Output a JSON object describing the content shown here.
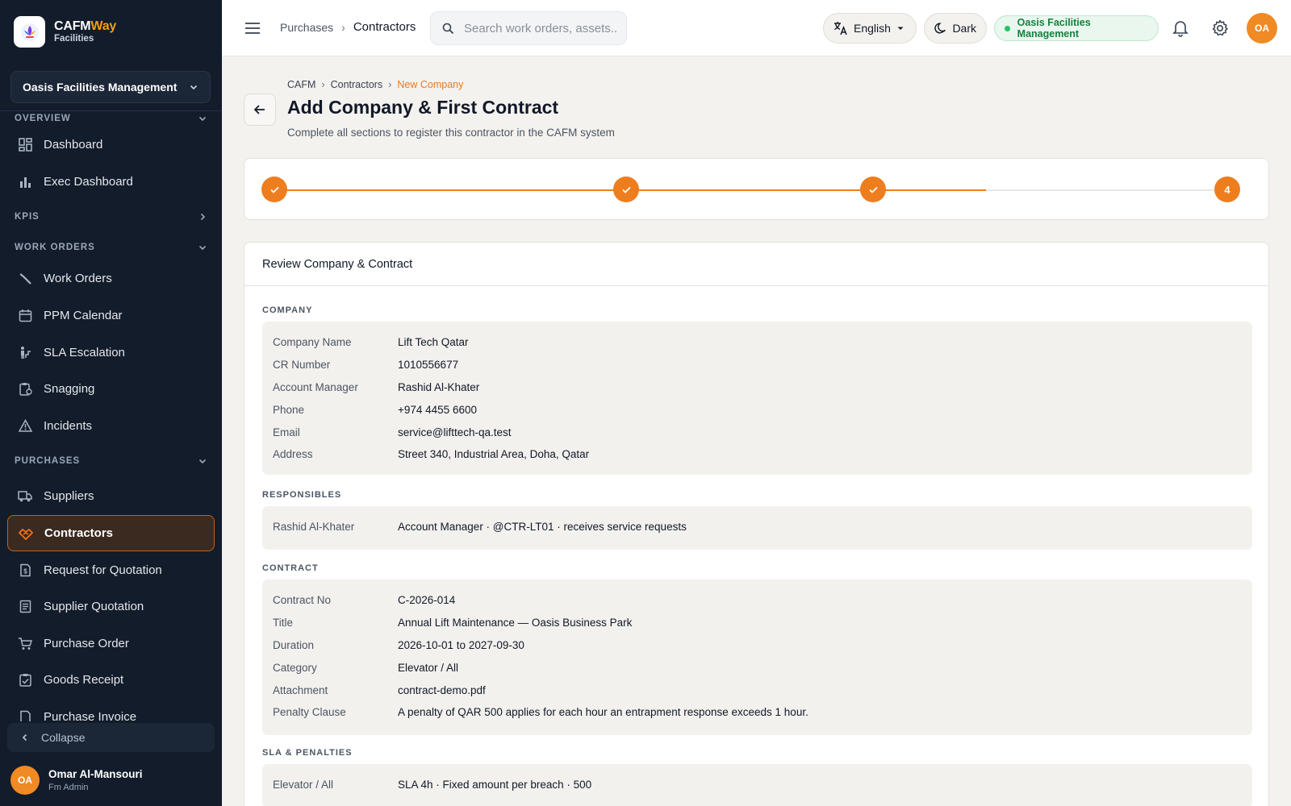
{
  "sidebar": {
    "brand_prefix": "CAFM",
    "brand_accent": "Way",
    "brand_sub": "Facilities",
    "org_select": "Oasis Facilities Management",
    "sections": {
      "overview": "OVERVIEW",
      "kpis": "KPIS",
      "work_orders": "WORK ORDERS",
      "purchases": "PURCHASES"
    },
    "items": {
      "dashboard": "Dashboard",
      "exec_dashboard": "Exec Dashboard",
      "work_orders": "Work Orders",
      "ppm_calendar": "PPM Calendar",
      "sla_escalation": "SLA Escalation",
      "snagging": "Snagging",
      "incidents": "Incidents",
      "suppliers": "Suppliers",
      "contractors": "Contractors",
      "rfq": "Request for Quotation",
      "supplier_quotation": "Supplier Quotation",
      "purchase_order": "Purchase Order",
      "goods_receipt": "Goods Receipt",
      "purchase_invoice": "Purchase Invoice"
    },
    "collapse": "Collapse",
    "user": {
      "initials": "OA",
      "name": "Omar Al-Mansouri",
      "role": "Fm Admin"
    }
  },
  "topbar": {
    "breadcrumb_parent": "Purchases",
    "breadcrumb_current": "Contractors",
    "search_placeholder": "Search work orders, assets...",
    "language": "English",
    "theme": "Dark",
    "org_badge": "Oasis Facilities Management",
    "avatar_initials": "OA"
  },
  "page": {
    "breadcrumb": [
      "CAFM",
      "Contractors",
      "New Company"
    ],
    "title": "Add Company & First Contract",
    "subtitle": "Complete all sections to register this contractor in the CAFM system"
  },
  "stepper": {
    "steps_completed": 3,
    "current_step_label": "4",
    "accent": "#ee7d1e"
  },
  "review": {
    "heading": "Review Company & Contract",
    "company": {
      "title": "COMPANY",
      "rows": [
        {
          "k": "Company Name",
          "v": "Lift Tech Qatar"
        },
        {
          "k": "CR Number",
          "v": "1010556677"
        },
        {
          "k": "Account Manager",
          "v": "Rashid Al-Khater"
        },
        {
          "k": "Phone",
          "v": "+974 4455 6600"
        },
        {
          "k": "Email",
          "v": "service@lifttech-qa.test"
        },
        {
          "k": "Address",
          "v": "Street 340, Industrial Area, Doha, Qatar"
        }
      ]
    },
    "responsibles": {
      "title": "RESPONSIBLES",
      "rows": [
        {
          "k": "Rashid Al-Khater",
          "v": "Account Manager · @CTR-LT01 · receives service requests"
        }
      ]
    },
    "contract": {
      "title": "CONTRACT",
      "rows": [
        {
          "k": "Contract No",
          "v": "C-2026-014"
        },
        {
          "k": "Title",
          "v": "Annual Lift Maintenance — Oasis Business Park"
        },
        {
          "k": "Duration",
          "v": "2026-10-01 to 2027-09-30"
        },
        {
          "k": "Category",
          "v": "Elevator / All"
        },
        {
          "k": "Attachment",
          "v": "contract-demo.pdf"
        },
        {
          "k": "Penalty Clause",
          "v": "A penalty of QAR 500 applies for each hour an entrapment response exceeds 1 hour."
        }
      ]
    },
    "sla": {
      "title": "SLA & PENALTIES",
      "rows": [
        {
          "k": "Elevator / All",
          "v": "SLA 4h · Fixed amount per breach · 500"
        }
      ]
    }
  }
}
